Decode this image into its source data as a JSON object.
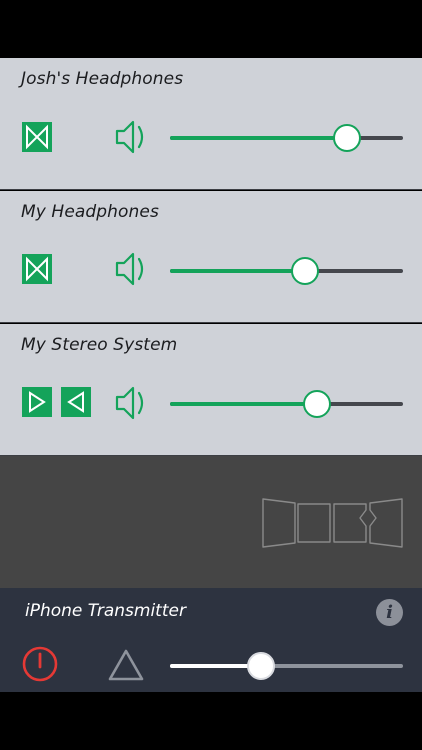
{
  "colors": {
    "accent": "#14a35a",
    "panel": "#cfd2d8",
    "track": "#45474d",
    "transmitter_bg": "#2d3340",
    "power": "#e53935"
  },
  "devices": [
    {
      "name": "Josh's Headphones",
      "channel_icon": "stereo-headphones-icon",
      "volume": 0.76
    },
    {
      "name": "My Headphones",
      "channel_icon": "stereo-headphones-icon",
      "volume": 0.58
    },
    {
      "name": "My Stereo System",
      "channel_icon": "left-right-speakers-icon",
      "volume": 0.63
    }
  ],
  "empty_area": {
    "icon": "room-panels-icon"
  },
  "transmitter": {
    "title": "iPhone Transmitter",
    "info_symbol": "i",
    "volume": 0.39,
    "icons": [
      "power-icon",
      "warning-triangle-icon",
      "info-icon"
    ]
  }
}
